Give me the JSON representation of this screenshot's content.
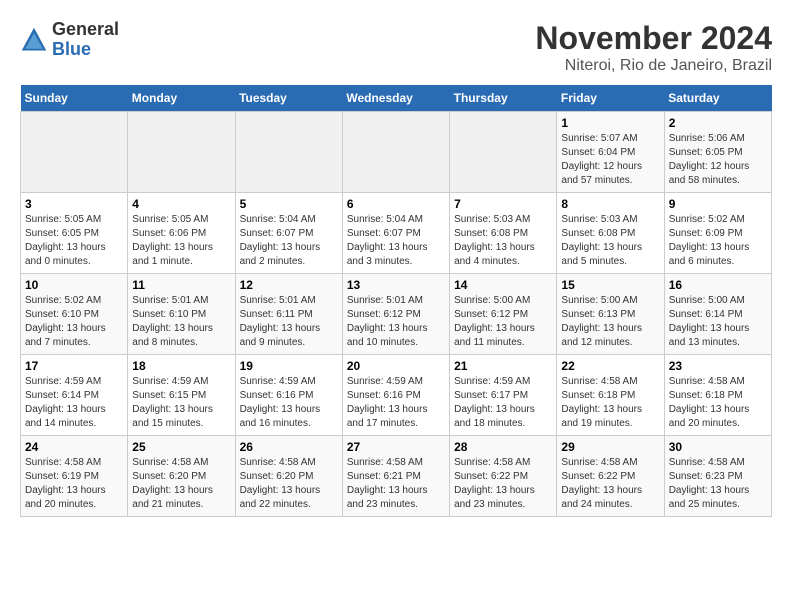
{
  "header": {
    "logo_general": "General",
    "logo_blue": "Blue",
    "month_title": "November 2024",
    "location": "Niteroi, Rio de Janeiro, Brazil"
  },
  "weekdays": [
    "Sunday",
    "Monday",
    "Tuesday",
    "Wednesday",
    "Thursday",
    "Friday",
    "Saturday"
  ],
  "weeks": [
    [
      {
        "day": "",
        "info": ""
      },
      {
        "day": "",
        "info": ""
      },
      {
        "day": "",
        "info": ""
      },
      {
        "day": "",
        "info": ""
      },
      {
        "day": "",
        "info": ""
      },
      {
        "day": "1",
        "info": "Sunrise: 5:07 AM\nSunset: 6:04 PM\nDaylight: 12 hours and 57 minutes."
      },
      {
        "day": "2",
        "info": "Sunrise: 5:06 AM\nSunset: 6:05 PM\nDaylight: 12 hours and 58 minutes."
      }
    ],
    [
      {
        "day": "3",
        "info": "Sunrise: 5:05 AM\nSunset: 6:05 PM\nDaylight: 13 hours and 0 minutes."
      },
      {
        "day": "4",
        "info": "Sunrise: 5:05 AM\nSunset: 6:06 PM\nDaylight: 13 hours and 1 minute."
      },
      {
        "day": "5",
        "info": "Sunrise: 5:04 AM\nSunset: 6:07 PM\nDaylight: 13 hours and 2 minutes."
      },
      {
        "day": "6",
        "info": "Sunrise: 5:04 AM\nSunset: 6:07 PM\nDaylight: 13 hours and 3 minutes."
      },
      {
        "day": "7",
        "info": "Sunrise: 5:03 AM\nSunset: 6:08 PM\nDaylight: 13 hours and 4 minutes."
      },
      {
        "day": "8",
        "info": "Sunrise: 5:03 AM\nSunset: 6:08 PM\nDaylight: 13 hours and 5 minutes."
      },
      {
        "day": "9",
        "info": "Sunrise: 5:02 AM\nSunset: 6:09 PM\nDaylight: 13 hours and 6 minutes."
      }
    ],
    [
      {
        "day": "10",
        "info": "Sunrise: 5:02 AM\nSunset: 6:10 PM\nDaylight: 13 hours and 7 minutes."
      },
      {
        "day": "11",
        "info": "Sunrise: 5:01 AM\nSunset: 6:10 PM\nDaylight: 13 hours and 8 minutes."
      },
      {
        "day": "12",
        "info": "Sunrise: 5:01 AM\nSunset: 6:11 PM\nDaylight: 13 hours and 9 minutes."
      },
      {
        "day": "13",
        "info": "Sunrise: 5:01 AM\nSunset: 6:12 PM\nDaylight: 13 hours and 10 minutes."
      },
      {
        "day": "14",
        "info": "Sunrise: 5:00 AM\nSunset: 6:12 PM\nDaylight: 13 hours and 11 minutes."
      },
      {
        "day": "15",
        "info": "Sunrise: 5:00 AM\nSunset: 6:13 PM\nDaylight: 13 hours and 12 minutes."
      },
      {
        "day": "16",
        "info": "Sunrise: 5:00 AM\nSunset: 6:14 PM\nDaylight: 13 hours and 13 minutes."
      }
    ],
    [
      {
        "day": "17",
        "info": "Sunrise: 4:59 AM\nSunset: 6:14 PM\nDaylight: 13 hours and 14 minutes."
      },
      {
        "day": "18",
        "info": "Sunrise: 4:59 AM\nSunset: 6:15 PM\nDaylight: 13 hours and 15 minutes."
      },
      {
        "day": "19",
        "info": "Sunrise: 4:59 AM\nSunset: 6:16 PM\nDaylight: 13 hours and 16 minutes."
      },
      {
        "day": "20",
        "info": "Sunrise: 4:59 AM\nSunset: 6:16 PM\nDaylight: 13 hours and 17 minutes."
      },
      {
        "day": "21",
        "info": "Sunrise: 4:59 AM\nSunset: 6:17 PM\nDaylight: 13 hours and 18 minutes."
      },
      {
        "day": "22",
        "info": "Sunrise: 4:58 AM\nSunset: 6:18 PM\nDaylight: 13 hours and 19 minutes."
      },
      {
        "day": "23",
        "info": "Sunrise: 4:58 AM\nSunset: 6:18 PM\nDaylight: 13 hours and 20 minutes."
      }
    ],
    [
      {
        "day": "24",
        "info": "Sunrise: 4:58 AM\nSunset: 6:19 PM\nDaylight: 13 hours and 20 minutes."
      },
      {
        "day": "25",
        "info": "Sunrise: 4:58 AM\nSunset: 6:20 PM\nDaylight: 13 hours and 21 minutes."
      },
      {
        "day": "26",
        "info": "Sunrise: 4:58 AM\nSunset: 6:20 PM\nDaylight: 13 hours and 22 minutes."
      },
      {
        "day": "27",
        "info": "Sunrise: 4:58 AM\nSunset: 6:21 PM\nDaylight: 13 hours and 23 minutes."
      },
      {
        "day": "28",
        "info": "Sunrise: 4:58 AM\nSunset: 6:22 PM\nDaylight: 13 hours and 23 minutes."
      },
      {
        "day": "29",
        "info": "Sunrise: 4:58 AM\nSunset: 6:22 PM\nDaylight: 13 hours and 24 minutes."
      },
      {
        "day": "30",
        "info": "Sunrise: 4:58 AM\nSunset: 6:23 PM\nDaylight: 13 hours and 25 minutes."
      }
    ]
  ]
}
